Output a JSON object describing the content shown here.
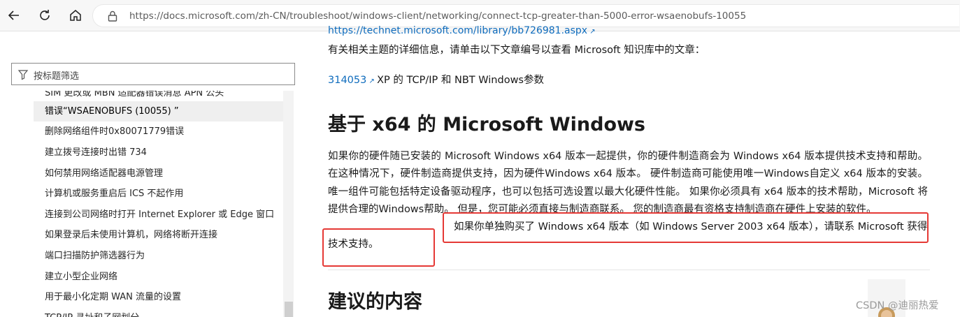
{
  "browser": {
    "url": "https://docs.microsoft.com/zh-CN/troubleshoot/windows-client/networking/connect-tcp-greater-than-5000-error-wsaenobufs-10055",
    "icons": [
      "back-arrow-icon",
      "refresh-icon",
      "home-icon",
      "lock-icon"
    ]
  },
  "sidebar": {
    "filter_placeholder": "按标题筛选",
    "items": [
      {
        "label": "SIM 更改或 MBN 适配器错误消息 APN 公头"
      },
      {
        "label": "错误“WSAENOBUFS (10055) ”",
        "active": true
      },
      {
        "label": "删除网络组件时0x80071779错误"
      },
      {
        "label": "建立拨号连接时出错 734"
      },
      {
        "label": "如何禁用网络适配器电源管理"
      },
      {
        "label": "计算机或服务重启后 ICS 不起作用"
      },
      {
        "label": "连接到公司网络时打开 Internet Explorer 或 Edge 窗口"
      },
      {
        "label": "如果登录后未使用计算机，网络将断开连接"
      },
      {
        "label": "端口扫描防护筛选器行为"
      },
      {
        "label": "建立小型企业网络"
      },
      {
        "label": "用于最小化定期 WAN 流量的设置"
      },
      {
        "label": "TCP/IP 寻址和子网划分"
      }
    ]
  },
  "main": {
    "top_link": "https://technet.microsoft.com/library/bb726981.aspx",
    "intro": "有关相关主题的详细信息，请单击以下文章编号以查看 Microsoft 知识库中的文章：",
    "kb_number": "314053",
    "kb_title": "XP 的 TCP/IP 和 NBT Windows参数",
    "heading_x64": "基于 x64 的 Microsoft Windows",
    "paragraph": "如果你的硬件随已安装的 Microsoft Windows x64 版本一起提供，你的硬件制造商会为 Windows x64 版本提供技术支持和帮助。 在这种情况下，硬件制造商提供支持，因为硬件Windows x64 版本。 硬件制造商可能使用唯一Windows自定义 x64 版本的安装。 唯一组件可能包括特定设备驱动程序，也可以包括可选设置以最大化硬件性能。 如果你必须具有 x64 版本的技术帮助，Microsoft 将提供合理的Windows帮助。 但是，您可能必须直接与制造商联系。 您的制造商最有资格支持制造商在硬件上安装的软件。",
    "paragraph_highlight": "如果你单独购买了 Windows x64 版本（如 Windows Server 2003 x64 版本），请联系 Microsoft 获得技术支持。",
    "heading_recommended": "建议的内容"
  },
  "watermark": "CSDN @迪丽热爱",
  "colors": {
    "link": "#0f6cbd",
    "annotation": "#e53935",
    "active_item_bg": "#efefef"
  }
}
